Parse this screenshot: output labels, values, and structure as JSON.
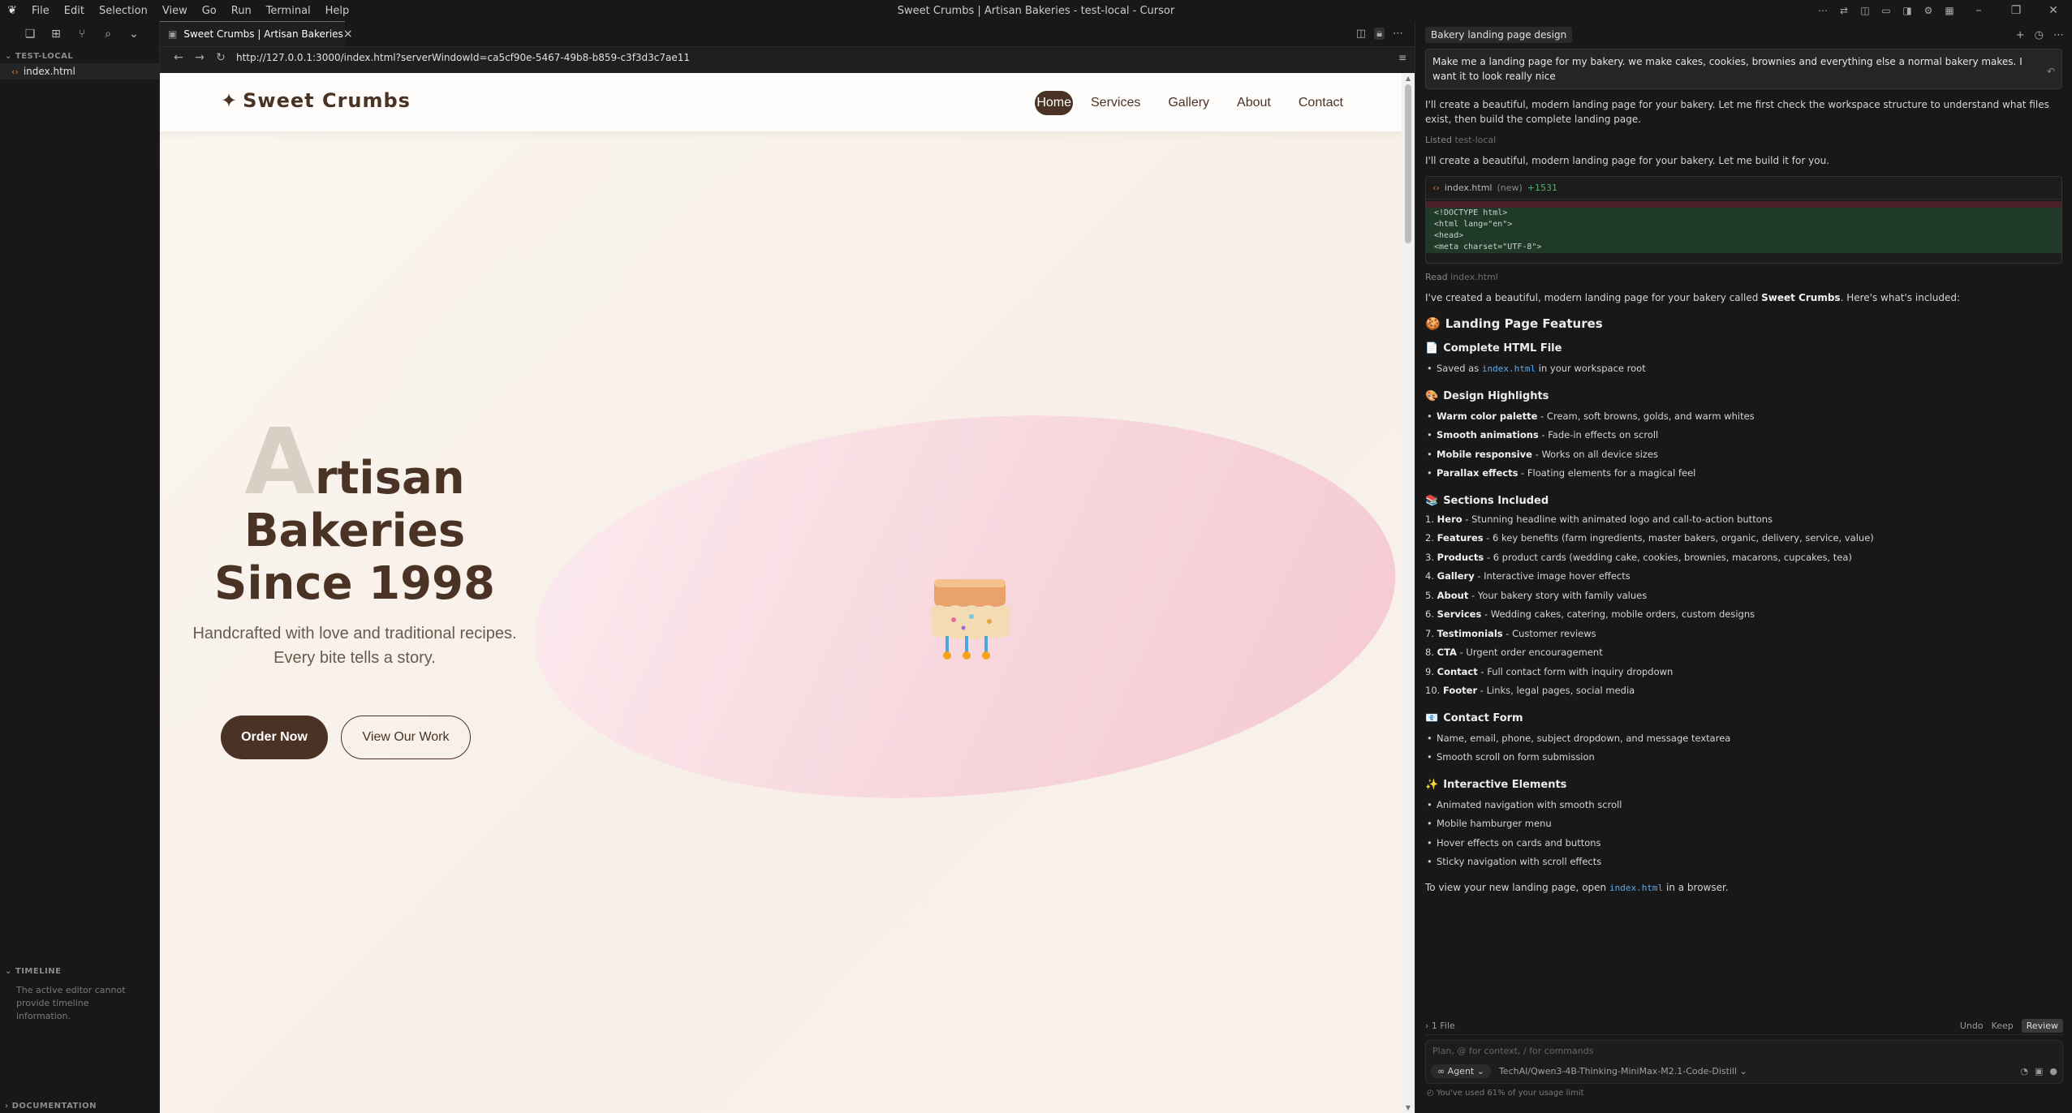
{
  "window": {
    "title": "Sweet Crumbs | Artisan Bakeries - test-local - Cursor",
    "menu": [
      "File",
      "Edit",
      "Selection",
      "View",
      "Go",
      "Run",
      "Terminal",
      "Help"
    ]
  },
  "sidebar": {
    "section": "TEST-LOCAL",
    "file": "index.html",
    "timeline_header": "TIMELINE",
    "timeline_message": "The active editor cannot provide timeline information.",
    "documentation_header": "DOCUMENTATION"
  },
  "editor": {
    "tab_label": "Sweet Crumbs | Artisan Bakeries",
    "url": "http://127.0.0.1:3000/index.html?serverWindowId=ca5cf90e-5467-49b8-b859-c3f3d3c7ae11"
  },
  "site": {
    "brand": "Sweet Crumbs",
    "brand_star": "✦",
    "nav": [
      "Home",
      "Services",
      "Gallery",
      "About",
      "Contact"
    ],
    "hero": {
      "big_letter": "A",
      "line1_rest": "rtisan",
      "line2": "Bakeries",
      "line3": "Since 1998",
      "sub1": "Handcrafted with love and traditional recipes.",
      "sub2": "Every bite tells a story.",
      "primary_cta": "Order Now",
      "secondary_cta": "View Our Work"
    },
    "colors": {
      "brown": "#4a3324",
      "pink": "#f7d4dc",
      "cream": "#faf5ef"
    }
  },
  "chat": {
    "tab": "Bakery landing page design",
    "user_message": "Make me a landing page for my bakery. we make cakes, cookies, brownies and everything else a normal bakery makes. I want it to look really nice",
    "reply1": "I'll create a beautiful, modern landing page for your bakery. Let me first check the workspace structure to understand what files exist, then build the complete landing page.",
    "listed_label": "Listed",
    "listed_target": "test-local",
    "reply2": "I'll create a beautiful, modern landing page for your bakery. Let me build it for you.",
    "code_file": "index.html",
    "code_new": "(new)",
    "code_plus": "+1531",
    "code_lines": [
      "<!DOCTYPE html>",
      "<html lang=\"en\">",
      "<head>",
      "    <meta charset=\"UTF-8\">"
    ],
    "read_label": "Read",
    "read_target": "index.html",
    "summary_pre": "I've created a beautiful, modern landing page for your bakery called ",
    "summary_brand": "Sweet Crumbs",
    "summary_post": ". Here's what's included:",
    "features_title": "Landing Page Features",
    "complete_title": "Complete HTML File",
    "saved_pre": "Saved as ",
    "saved_file": "index.html",
    "saved_post": " in your workspace root",
    "design_title": "Design Highlights",
    "design_items": [
      {
        "b": "Warm color palette",
        "t": " - Cream, soft browns, golds, and warm whites"
      },
      {
        "b": "Smooth animations",
        "t": " - Fade-in effects on scroll"
      },
      {
        "b": "Mobile responsive",
        "t": " - Works on all device sizes"
      },
      {
        "b": "Parallax effects",
        "t": " - Floating elements for a magical feel"
      }
    ],
    "sections_title": "Sections Included",
    "sections_items": [
      {
        "n": "1.",
        "b": "Hero",
        "t": " - Stunning headline with animated logo and call-to-action buttons"
      },
      {
        "n": "2.",
        "b": "Features",
        "t": " - 6 key benefits (farm ingredients, master bakers, organic, delivery, service, value)"
      },
      {
        "n": "3.",
        "b": "Products",
        "t": " - 6 product cards (wedding cake, cookies, brownies, macarons, cupcakes, tea)"
      },
      {
        "n": "4.",
        "b": "Gallery",
        "t": " - Interactive image hover effects"
      },
      {
        "n": "5.",
        "b": "About",
        "t": " - Your bakery story with family values"
      },
      {
        "n": "6.",
        "b": "Services",
        "t": " - Wedding cakes, catering, mobile orders, custom designs"
      },
      {
        "n": "7.",
        "b": "Testimonials",
        "t": " - Customer reviews"
      },
      {
        "n": "8.",
        "b": "CTA",
        "t": " - Urgent order encouragement"
      },
      {
        "n": "9.",
        "b": "Contact",
        "t": " - Full contact form with inquiry dropdown"
      },
      {
        "n": "10.",
        "b": "Footer",
        "t": " - Links, legal pages, social media"
      }
    ],
    "contact_title": "Contact Form",
    "contact_items": [
      "Name, email, phone, subject dropdown, and message textarea",
      "Smooth scroll on form submission"
    ],
    "interactive_title": "Interactive Elements",
    "interactive_items": [
      "Animated navigation with smooth scroll",
      "Mobile hamburger menu",
      "Hover effects on cards and buttons",
      "Sticky navigation with scroll effects"
    ],
    "closing_pre": "To view your new landing page, open ",
    "closing_file": "index.html",
    "closing_post": " in a browser.",
    "files_count": "1 File",
    "undo": "Undo",
    "keep": "Keep",
    "review": "Review",
    "composer_placeholder": "Plan, @ for context, / for commands",
    "agent": "Agent",
    "model": "TechAI/Qwen3-4B-Thinking-MiniMax-M2.1-Code-Distill",
    "usage": "You've used 61% of your usage limit"
  }
}
